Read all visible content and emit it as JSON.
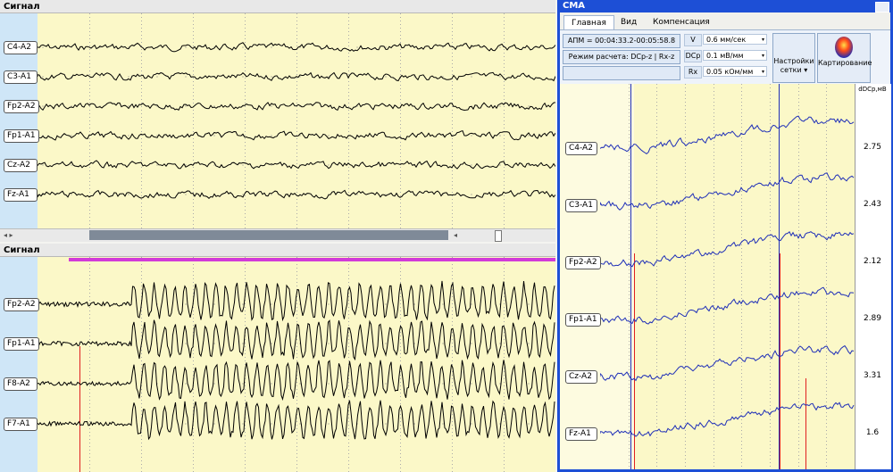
{
  "top_panel": {
    "title": "Сигнал",
    "channels": [
      "C4-A2",
      "C3-A1",
      "Fp2-A2",
      "Fp1-A1",
      "Cz-A2",
      "Fz-A1"
    ]
  },
  "bottom_panel": {
    "title": "Сигнал",
    "channels": [
      "Fp2-A2",
      "Fp1-A1",
      "F8-A2",
      "F7-A1"
    ]
  },
  "cma": {
    "title": "СМА",
    "tabs": [
      "Главная",
      "Вид",
      "Компенсация"
    ],
    "apm": "АПМ = 00:04:33.2-00:05:58.8",
    "mode": "Режим расчета: DCp-z | Rx-z",
    "params": [
      {
        "label": "V",
        "value": "0.6 мм/сек"
      },
      {
        "label": "DCp",
        "value": "0.1 мВ/мм"
      },
      {
        "label": "Rx",
        "value": "0.05 кОм/мм"
      }
    ],
    "grid_button": "Настройки сетки ▾",
    "map_button": "Картирование",
    "value_header": "dDCp,мВ",
    "channels": [
      "C4-A2",
      "C3-A1",
      "Fp2-A2",
      "Fp1-A1",
      "Cz-A2",
      "Fz-A1"
    ],
    "values": [
      "2.75",
      "2.43",
      "2.12",
      "2.89",
      "3.31",
      "1.6"
    ]
  },
  "colors": {
    "plot_bg": "#fbf8c8",
    "label_col": "#cfe6f7",
    "trace_black": "#000000",
    "trace_blue": "#1f2fb8",
    "marker_red": "#e02020",
    "selection_magenta": "#d23ad8",
    "window_blue": "#1d4fd6"
  }
}
